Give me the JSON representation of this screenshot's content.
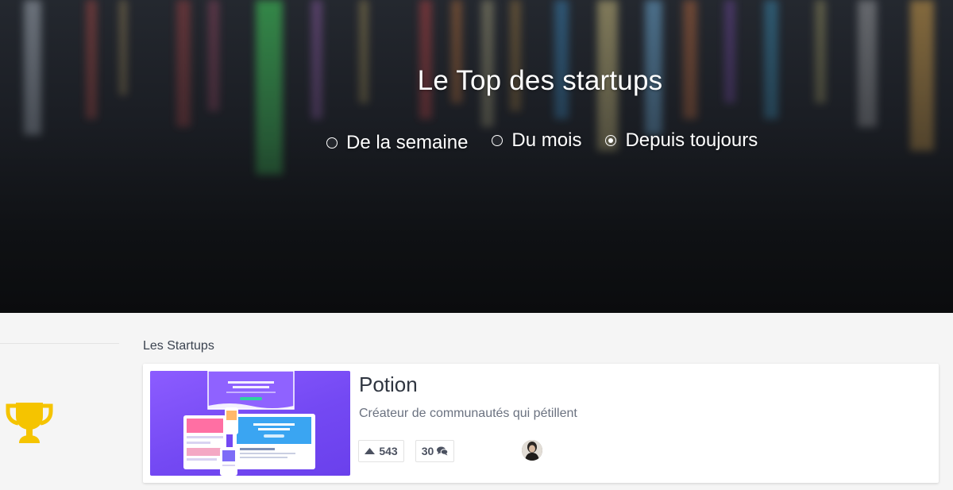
{
  "hero": {
    "title": "Le Top des startups",
    "options": [
      {
        "label": "De la semaine",
        "checked": false
      },
      {
        "label": "Du mois",
        "checked": false
      },
      {
        "label": "Depuis toujours",
        "checked": true
      }
    ]
  },
  "section": {
    "title": "Les Startups",
    "icon": "trophy-icon"
  },
  "startups": [
    {
      "name": "Potion",
      "tagline": "Créateur de communautés qui pétillent",
      "upvotes": "543",
      "comments": "30",
      "upvote_icon": "triangle-up-icon",
      "comment_icon": "comments-icon"
    }
  ],
  "colors": {
    "trophy": "#f5c400",
    "thumb_purple": "#7449f3",
    "text_dark": "#2f3540",
    "text_muted": "#6b7280"
  }
}
